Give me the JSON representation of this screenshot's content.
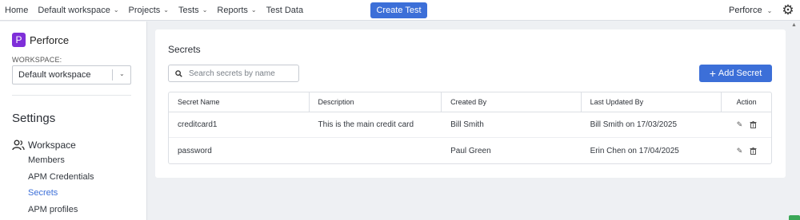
{
  "nav": {
    "items": [
      {
        "label": "Home",
        "has_dropdown": false
      },
      {
        "label": "Default workspace",
        "has_dropdown": true
      },
      {
        "label": "Projects",
        "has_dropdown": true
      },
      {
        "label": "Tests",
        "has_dropdown": true
      },
      {
        "label": "Reports",
        "has_dropdown": true
      },
      {
        "label": "Test Data",
        "has_dropdown": false
      }
    ],
    "create_button": "Create Test",
    "user": "Perforce",
    "settings_icon": "gear-icon"
  },
  "sidebar": {
    "org_initial": "P",
    "org_name": "Perforce",
    "workspace_label": "WORKSPACE:",
    "workspace_value": "Default workspace",
    "settings_title": "Settings",
    "section_label": "Workspace",
    "links": [
      "Members",
      "APM Credentials",
      "Secrets",
      "APM profiles"
    ],
    "active_link": "Secrets"
  },
  "main": {
    "title": "Secrets",
    "search_placeholder": "Search secrets by name",
    "add_button": "Add Secret",
    "columns": [
      "Secret Name",
      "Description",
      "Created By",
      "Last Updated By",
      "Action"
    ],
    "rows": [
      {
        "name": "creditcard1",
        "description": "This is the main credit card",
        "created_by": "Bill Smith",
        "updated_by": "Bill Smith on 17/03/2025"
      },
      {
        "name": "password",
        "description": "",
        "created_by": "Paul Green",
        "updated_by": "Erin Chen on 17/04/2025"
      }
    ]
  },
  "colors": {
    "accent": "#3c6fd8",
    "brand": "#7f2fd9"
  }
}
